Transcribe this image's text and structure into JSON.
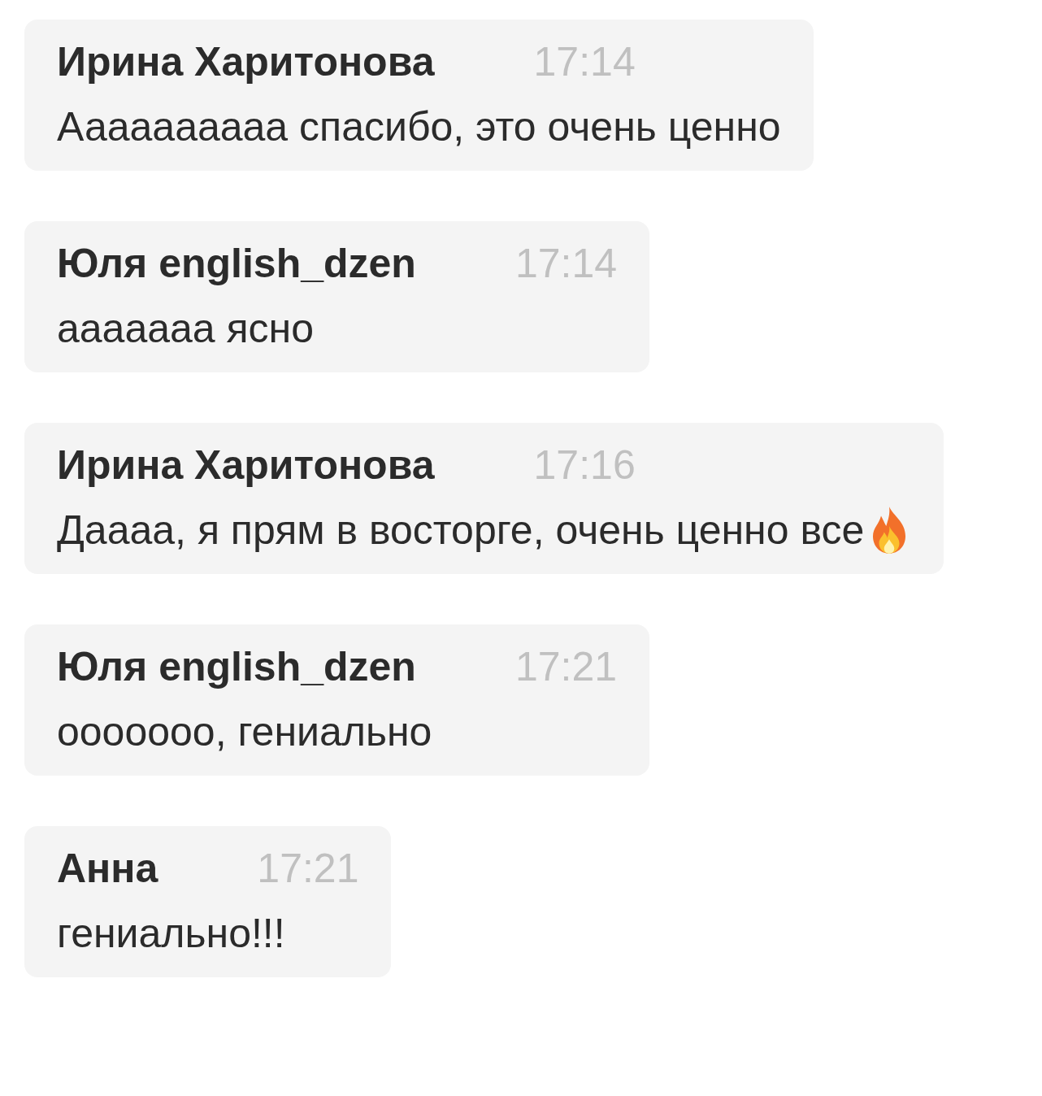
{
  "messages": [
    {
      "author": "Ирина Харитонова",
      "time": "17:14",
      "text": "Аааааааааа спасибо, это очень ценно"
    },
    {
      "author": "Юля english_dzen",
      "time": "17:14",
      "text": "ааааааа ясно"
    },
    {
      "author": "Ирина Харитонова",
      "time": "17:16",
      "text": "Даааа, я прям в восторге, очень ценно все",
      "emoji": {
        "kind": "fire"
      }
    },
    {
      "author": "Юля english_dzen",
      "time": "17:21",
      "text": "ооооооо, гениально"
    },
    {
      "author": "Анна",
      "time": "17:21",
      "text": "гениально!!!"
    }
  ]
}
